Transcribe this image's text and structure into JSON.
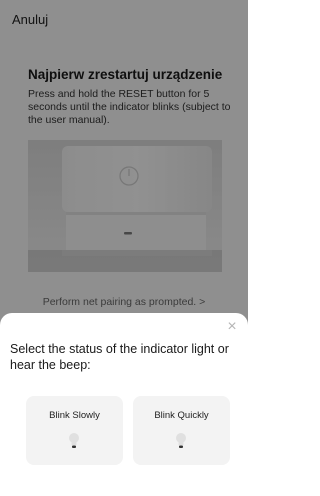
{
  "header": {
    "cancel_label": "Anuluj"
  },
  "setup": {
    "title": "Najpierw zrestartuj urządzenie",
    "description": "Press and hold the RESET button for 5 seconds until the indicator blinks (subject to the user manual).",
    "pairing_hint": "Perform net pairing as prompted. >"
  },
  "sheet": {
    "close_icon": "close-icon",
    "title": "Select the status of the indicator light or hear the beep:",
    "options": [
      {
        "label": "Blink Slowly",
        "icon": "bulb-icon"
      },
      {
        "label": "Blink Quickly",
        "icon": "bulb-icon"
      }
    ]
  }
}
